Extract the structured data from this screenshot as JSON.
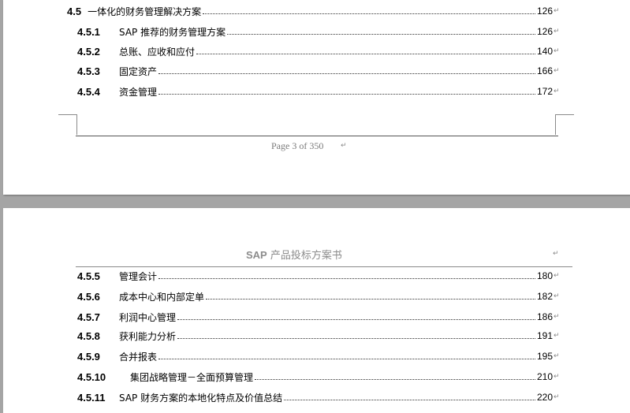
{
  "page1": {
    "toc": [
      {
        "num": "4.5",
        "text": "一体化的财务管理解决方案",
        "page": "126"
      },
      {
        "num": "4.5.1",
        "text": "SAP 推荐的财务管理方案",
        "page": "126"
      },
      {
        "num": "4.5.2",
        "text": "总账、应收和应付",
        "page": "140"
      },
      {
        "num": "4.5.3",
        "text": "固定资产",
        "page": "166"
      },
      {
        "num": "4.5.4",
        "text": "资金管理",
        "page": "172"
      }
    ],
    "footer": "Page 3 of 350"
  },
  "page2": {
    "header_brand": "SAP",
    "header_title": "产品投标方案书",
    "toc": [
      {
        "num": "4.5.5",
        "text": "管理会计",
        "page": "180"
      },
      {
        "num": "4.5.6",
        "text": "成本中心和内部定单",
        "page": "182"
      },
      {
        "num": "4.5.7",
        "text": "利润中心管理",
        "page": "186"
      },
      {
        "num": "4.5.8",
        "text": "获利能力分析",
        "page": "191"
      },
      {
        "num": "4.5.9",
        "text": "合并报表",
        "page": "195"
      },
      {
        "num": "4.5.10",
        "text": "集团战略管理－全面预算管理",
        "page": "210"
      },
      {
        "num": "4.5.11",
        "text": "SAP 财务方案的本地化特点及价值总结",
        "page": "220"
      }
    ]
  },
  "paragraph_mark": "↵"
}
